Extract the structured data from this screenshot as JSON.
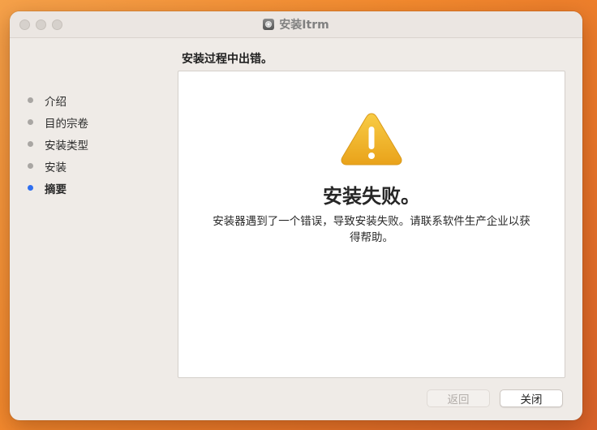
{
  "window": {
    "title": "安装Itrm"
  },
  "header": {
    "text": "安装过程中出错。"
  },
  "sidebar": {
    "steps": [
      {
        "label": "介绍",
        "active": false
      },
      {
        "label": "目的宗卷",
        "active": false
      },
      {
        "label": "安装类型",
        "active": false
      },
      {
        "label": "安装",
        "active": false
      },
      {
        "label": "摘要",
        "active": true
      }
    ]
  },
  "main": {
    "icon": "warning-icon",
    "title": "安装失败。",
    "message": "安装器遇到了一个错误，导致安装失败。请联系软件生产企业以获得帮助。"
  },
  "buttons": {
    "back_label": "返回",
    "close_label": "关闭"
  },
  "colors": {
    "accent": "#2f6ff0",
    "warning_yellow": "#f1b423",
    "desktop_orange": "#f38a2e"
  }
}
